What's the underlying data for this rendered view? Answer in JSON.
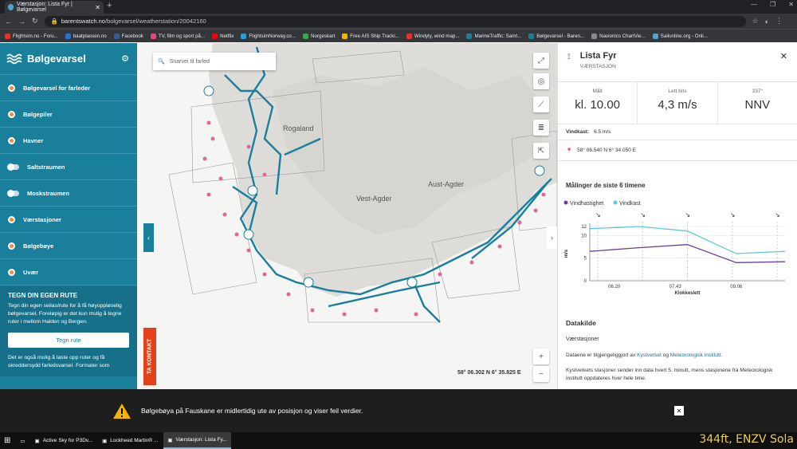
{
  "browser": {
    "tab_title": "Værstasjon: Lista Fyr | Bølgevarsel",
    "url_host": "barentswatch.no",
    "url_path": "/bolgevarsel/weatherstation/20042160",
    "bookmarks": [
      {
        "label": "Flightsim.no - Foru...",
        "color": "#d33"
      },
      {
        "label": "baatplassen.no",
        "color": "#2a6fc9"
      },
      {
        "label": "Facebook",
        "color": "#3b5998"
      },
      {
        "label": "TV, film og sport på...",
        "color": "#e8457a"
      },
      {
        "label": "Netflix",
        "color": "#e50914"
      },
      {
        "label": "FlightsimNorway.co...",
        "color": "#2d9cdb"
      },
      {
        "label": "Norgeskart",
        "color": "#3aa655"
      },
      {
        "label": "Free AIS Ship Tracki...",
        "color": "#f5b400"
      },
      {
        "label": "Windyty, wind map...",
        "color": "#d33"
      },
      {
        "label": "MarineTraffic: Samt...",
        "color": "#1a7f9b"
      },
      {
        "label": "Bølgevarsel - Baren...",
        "color": "#1a7f9b"
      },
      {
        "label": "Navionics ChartVie...",
        "color": "#888"
      },
      {
        "label": "Sailonline.org - Onli...",
        "color": "#4fa3d1"
      }
    ]
  },
  "sidebar": {
    "brand": "Bølgevarsel",
    "items": [
      {
        "label": "Bølgevarsel for farleder",
        "kind": "dot"
      },
      {
        "label": "Bølgepiler",
        "kind": "dot"
      },
      {
        "label": "Havner",
        "kind": "dot"
      },
      {
        "label": "Saltstraumen",
        "kind": "toggle"
      },
      {
        "label": "Moskstraumen",
        "kind": "toggle"
      },
      {
        "label": "Værstasjoner",
        "kind": "dot"
      },
      {
        "label": "Bølgebøye",
        "kind": "dot"
      },
      {
        "label": "Uvær",
        "kind": "dot"
      }
    ],
    "route_title": "TEGN DIN EGEN RUTE",
    "route_text": "Tegn din egen seilas/rute for å få høyoppløselig bølgevarsel. Foreløpig er det kun mulig å tegne ruter i mellom Halden og Bergen.",
    "route_button": "Tegn rute",
    "route_text2": "Det er også mulig å laste opp ruter og få skreddersydd farledsvarsel. Formater som"
  },
  "map": {
    "search_placeholder": "Snarvei til farled",
    "contact_label": "TA KONTAKT",
    "coords": "58° 06.302 N 6° 35.825 E",
    "place_labels": [
      "Rogaland",
      "Vest-Agder",
      "Aust-Agder"
    ]
  },
  "panel": {
    "title": "Lista Fyr",
    "subtitle": "VÆRSTASJON",
    "metrics": [
      {
        "label": "Målt",
        "value": "kl. 10.00"
      },
      {
        "label": "Lett bris",
        "value": "4,3 m/s"
      },
      {
        "label": "337°",
        "value": "NNV"
      }
    ],
    "gust_label": "Vindkast:",
    "gust_value": "6.5 m/s",
    "position": "58° 06.540 N 6° 34.050 E",
    "chart_heading": "Målinger de siste 6 timene",
    "datakilde": "Datakilde",
    "source_type": "Værstasjoner",
    "source_text1a": "Dataene er tilgjengeliggjort av",
    "source_link1": "Kystverket",
    "source_and": "og",
    "source_link2": "Meteorologisk institutt.",
    "source_text2": "Kystverkets stasjoner sender inn data hvert 5. minutt, mens stasjonene fra Meteorologisk institutt oppdateres hver hele time."
  },
  "chart_data": {
    "type": "line",
    "series": [
      {
        "name": "Vindhastighet",
        "color": "#6b3f9c",
        "values": [
          6.5,
          7.3,
          8.0,
          4.0,
          4.2
        ]
      },
      {
        "name": "Vindkast",
        "color": "#5fc8dc",
        "values": [
          11.5,
          12.0,
          11.0,
          6.0,
          6.5
        ]
      }
    ],
    "x": [
      0,
      1,
      2,
      3,
      4
    ],
    "tick_labels": [
      "06.20",
      "07.43",
      "09.06"
    ],
    "xlabel": "Klokkeslett",
    "ylabel": "m/s",
    "ylim": [
      0,
      12
    ],
    "yticks": [
      0,
      5,
      10,
      12
    ]
  },
  "notice": {
    "text": "Bølgebøya på Fauskane er midlertidig ute av posisjon og viser feil verdier."
  },
  "taskbar": {
    "items": [
      {
        "label": "Active Sky for P3Dv..."
      },
      {
        "label": "Lockheed Martin® ..."
      },
      {
        "label": "Værstasjon: Lista Fy..."
      }
    ],
    "overlay": "344ft, ENZV Sola"
  }
}
